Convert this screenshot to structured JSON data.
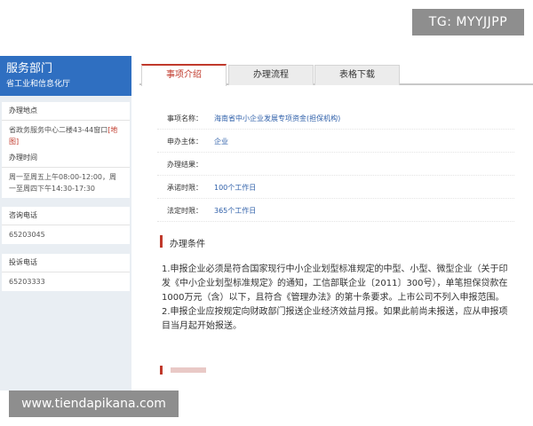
{
  "watermark": {
    "top": "TG: MYYJJPP",
    "bottom": "www.tiendapikana.com"
  },
  "sidebar": {
    "title": "服务部门",
    "subtitle": "省工业和信息化厅",
    "cards": [
      {
        "label": "办理地点",
        "value": "省政务服务中心二楼43-44窗口",
        "link": "[地图]"
      },
      {
        "label": "办理时间",
        "value": "周一至周五上午08:00-12:00，周一至周四下午14:30-17:30"
      },
      {
        "label": "咨询电话",
        "value": "65203045"
      },
      {
        "label": "投诉电话",
        "value": "65203333"
      }
    ]
  },
  "tabs": [
    {
      "label": "事项介绍",
      "active": true
    },
    {
      "label": "办理流程",
      "active": false
    },
    {
      "label": "表格下载",
      "active": false
    }
  ],
  "info": [
    {
      "key": "事项名称：",
      "value": "海南省中小企业发展专项资金(担保机构)"
    },
    {
      "key": "申办主体：",
      "value": "企业"
    },
    {
      "key": "办理结果：",
      "value": ""
    },
    {
      "key": "承诺时限：",
      "value": "100个工作日"
    },
    {
      "key": "法定时限：",
      "value": "365个工作日"
    }
  ],
  "conditions": {
    "title": "办理条件",
    "items": [
      "1.申报企业必须是符合国家现行中小企业划型标准规定的中型、小型、微型企业（关于印发《中小企业划型标准规定》的通知，工信部联企业〔2011〕300号），单笔担保贷款在1000万元（含）以下，且符合《管理办法》的第十条要求。上市公司不列入申报范围。",
      "2.申报企业应按规定向财政部门报送企业经济效益月报。如果此前尚未报送，应从申报项目当月起开始报送。"
    ]
  },
  "colors": {
    "accent": "#c0392b",
    "brand": "#2f6fc1",
    "link": "#2e5fa9"
  }
}
